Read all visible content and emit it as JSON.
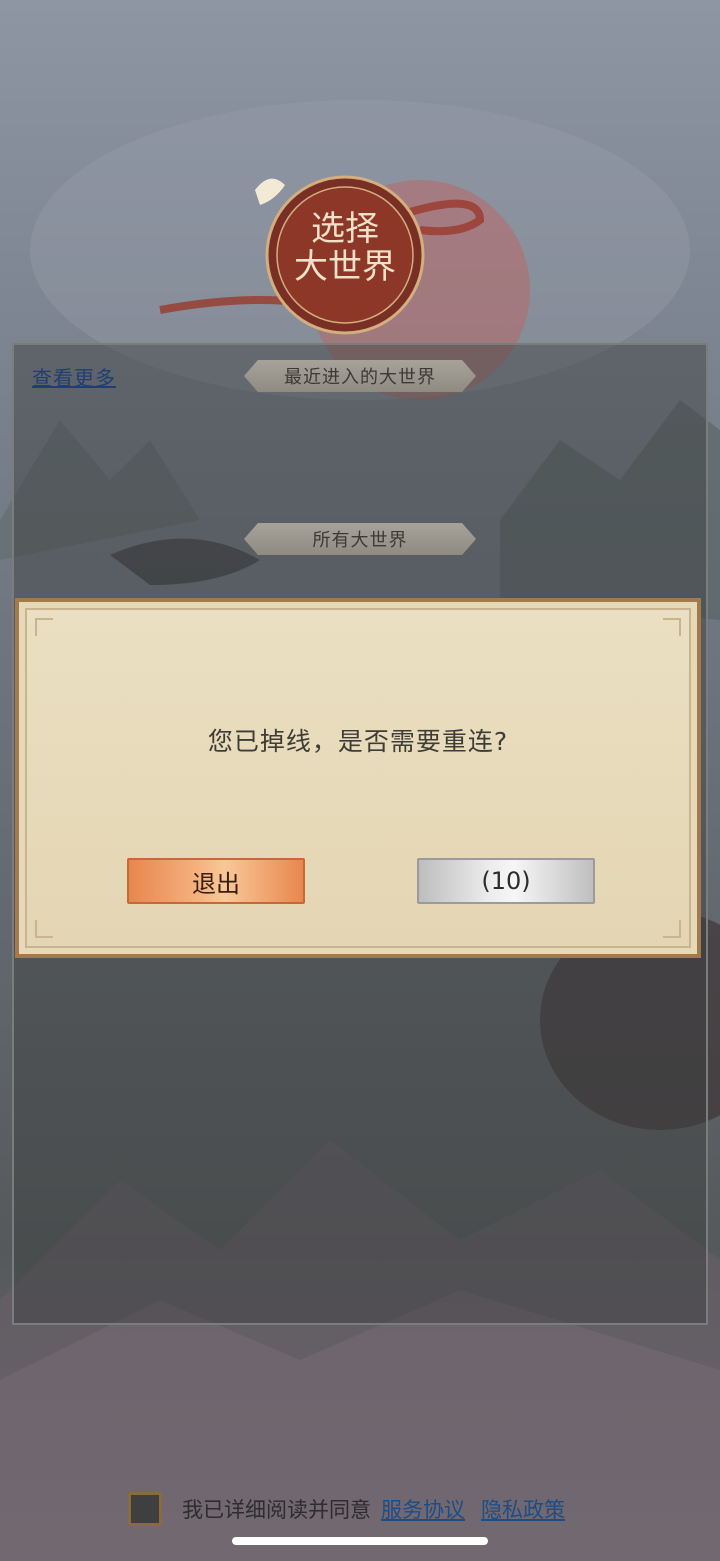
{
  "header": {
    "emblem_text": "选择大世界"
  },
  "panel": {
    "see_more_link": "查看更多",
    "recent_section_label": "最近进入的大世界",
    "all_section_label": "所有大世界"
  },
  "dialog": {
    "message": "您已掉线，是否需要重连?",
    "exit_button_label": "退出",
    "reconnect_countdown_label": "(10)"
  },
  "agreement": {
    "text": "我已详细阅读并同意",
    "service_link": "服务协议",
    "privacy_link": "隐私政策",
    "checked": false
  },
  "colors": {
    "accent_orange": "#e9864f",
    "dialog_bg": "#e6d9b8",
    "link_blue": "#1e4c86"
  }
}
